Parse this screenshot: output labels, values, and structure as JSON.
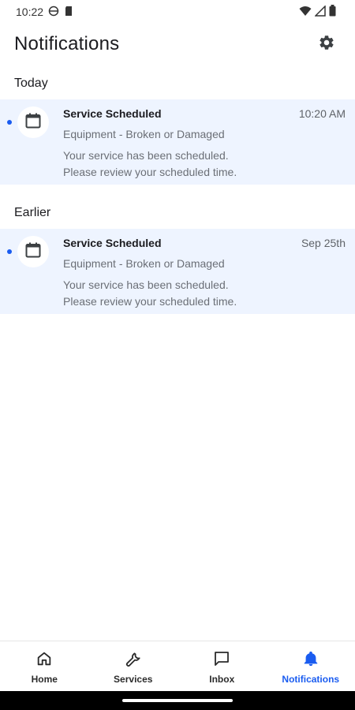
{
  "status_bar": {
    "time": "10:22"
  },
  "header": {
    "title": "Notifications"
  },
  "sections": {
    "today": {
      "label": "Today"
    },
    "earlier": {
      "label": "Earlier"
    }
  },
  "notifications": [
    {
      "title": "Service Scheduled",
      "time": "10:20 AM",
      "subtitle": "Equipment - Broken or Damaged",
      "body_line1": "Your service has been scheduled.",
      "body_line2": "Please review your scheduled time.",
      "unread": true
    },
    {
      "title": "Service Scheduled",
      "time": "Sep 25th",
      "subtitle": "Equipment - Broken or Damaged",
      "body_line1": "Your service has been scheduled.",
      "body_line2": "Please review your scheduled time.",
      "unread": true
    }
  ],
  "bottom_nav": {
    "items": [
      {
        "label": "Home",
        "icon": "home-icon"
      },
      {
        "label": "Services",
        "icon": "wrench-icon"
      },
      {
        "label": "Inbox",
        "icon": "chat-icon"
      },
      {
        "label": "Notifications",
        "icon": "bell-icon"
      }
    ],
    "active": "Notifications"
  },
  "colors": {
    "accent": "#1a5cf0",
    "card_background": "#eef4ff",
    "text_primary": "#1b1b1f",
    "text_secondary": "#6b6f76"
  }
}
